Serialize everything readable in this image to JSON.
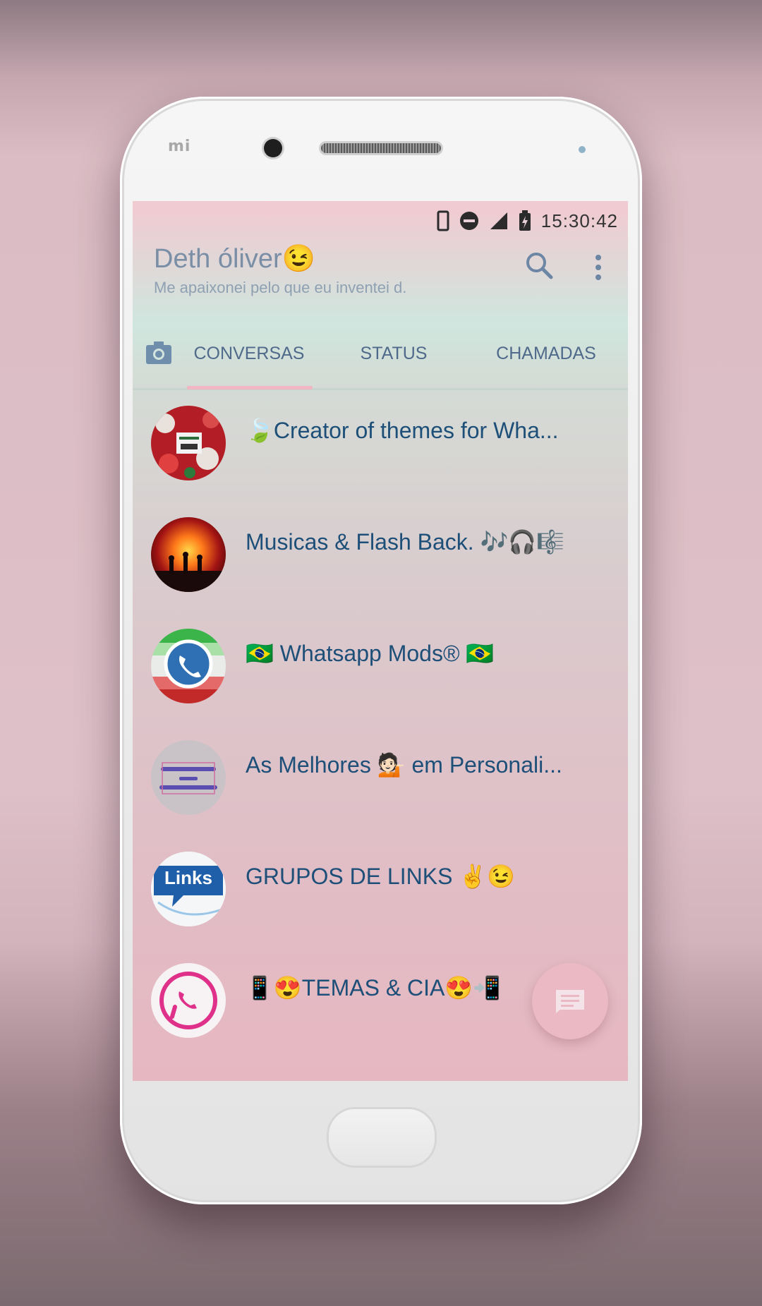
{
  "device": {
    "brand_mark": "mi"
  },
  "status_bar": {
    "time": "15:30:42",
    "icons": [
      "phone-vibrate-icon",
      "do-not-disturb-icon",
      "signal-icon",
      "battery-icon"
    ]
  },
  "header": {
    "title": "Deth óliver😉",
    "subtitle": "Me apaixonei pelo que eu inventei d.",
    "search_icon": "search-icon",
    "menu_icon": "more-vert-icon"
  },
  "tabs": {
    "camera_icon": "camera-icon",
    "items": [
      {
        "label": "CONVERSAS",
        "active": true
      },
      {
        "label": "STATUS",
        "active": false
      },
      {
        "label": "CHAMADAS",
        "active": false
      }
    ]
  },
  "chats": [
    {
      "name": "🍃Creator of themes for Wha...",
      "avatar": "christmas-avatar"
    },
    {
      "name": "Musicas & Flash Back. 🎶🎧🎼",
      "avatar": "concert-avatar"
    },
    {
      "name": "🇧🇷 Whatsapp Mods® 🇧🇷",
      "avatar": "whatsapp-mods-avatar"
    },
    {
      "name": "As Melhores 💁🏻 em Personali...",
      "avatar": "melhores-avatar"
    },
    {
      "name": "GRUPOS DE LINKS ✌️😉",
      "avatar": "links-avatar",
      "avatar_text": "Links"
    },
    {
      "name": "📱😍TEMAS & CIA😍📲",
      "avatar": "temas-avatar"
    }
  ],
  "fab": {
    "icon": "new-chat-icon"
  },
  "colors": {
    "accent": "#f0b6c2",
    "title": "#7a8ea6",
    "tab_text": "#4f6a8a",
    "chat_name": "#1d4f78",
    "fab": "#ebb9c4"
  }
}
